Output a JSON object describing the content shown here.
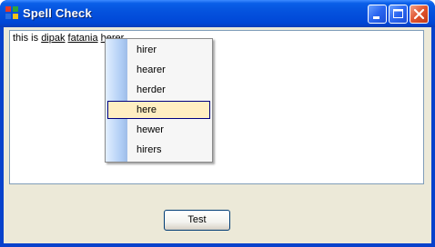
{
  "window": {
    "title": "Spell Check"
  },
  "editor": {
    "words": [
      {
        "text": "this is ",
        "misspelled": false
      },
      {
        "text": "dipak",
        "misspelled": true
      },
      {
        "text": " ",
        "misspelled": false
      },
      {
        "text": "fatania",
        "misspelled": true
      },
      {
        "text": " ",
        "misspelled": false
      },
      {
        "text": "herer",
        "misspelled": true
      }
    ]
  },
  "context_menu": {
    "items": [
      "hirer",
      "hearer",
      "herder",
      "here",
      "hewer",
      "hirers"
    ],
    "selected_index": 3
  },
  "buttons": {
    "test_label": "Test"
  },
  "colors": {
    "titlebar": "#0553de",
    "client_bg": "#ece9d8",
    "menu_selection": "#ffeec2",
    "close_button": "#e0532e"
  }
}
